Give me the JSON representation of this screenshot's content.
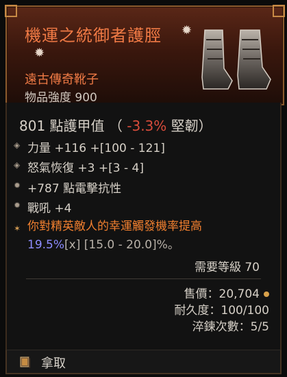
{
  "item": {
    "title": "機運之統御者護脛",
    "type": "遠古傳奇靴子",
    "power": "物品強度 900",
    "armor_value": "801 點護甲值",
    "armor_toughness_prefix": "（",
    "armor_toughness_change": "-3.3%",
    "armor_toughness_suffix": "堅韌）",
    "affixes": [
      {
        "text": "力量 +116 +[100 - 121]"
      },
      {
        "text": "怒氣恢復 +3 +[3 - 4]"
      },
      {
        "text": "+787 點電擊抗性"
      },
      {
        "text": "戰吼 +4"
      }
    ],
    "legendary_line1": "你對精英敵人的幸運觸發機率提高",
    "legendary_value": "19.5%",
    "legendary_marker": "[x]",
    "legendary_range": "[15.0 - 20.0]%。",
    "required_level": "需要等級 70",
    "sell_value": "售價：20,704",
    "durability": "耐久度：100/100",
    "tempering": "淬鍊次數：5/5"
  },
  "footer": {
    "action_label": "拿取"
  },
  "colors": {
    "title": "#f07a45",
    "legendary": "#f07f2f",
    "value": "#8d8cff",
    "negative": "#d84c3b"
  },
  "icons": {
    "footer_icon": "book-icon",
    "boots_icon": "boots-icon"
  }
}
